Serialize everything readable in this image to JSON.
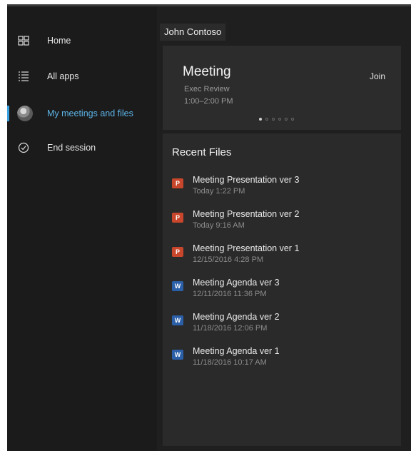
{
  "sidebar": {
    "items": [
      {
        "label": "Home",
        "icon": "home-icon"
      },
      {
        "label": "All apps",
        "icon": "all-apps-icon"
      },
      {
        "label": "My meetings and files",
        "icon": "avatar"
      },
      {
        "label": "End session",
        "icon": "check-circle-icon"
      }
    ]
  },
  "user": {
    "name": "John Contoso"
  },
  "meeting": {
    "title": "Meeting",
    "subtitle": "Exec Review",
    "time": "1:00–2:00 PM",
    "join_label": "Join",
    "page_count": 6,
    "current_page": 1
  },
  "recent": {
    "title": "Recent Files",
    "files": [
      {
        "name": "Meeting Presentation ver 3",
        "date": "Today 1:22 PM",
        "type": "ppt"
      },
      {
        "name": "Meeting Presentation ver 2",
        "date": "Today 9:16 AM",
        "type": "ppt"
      },
      {
        "name": "Meeting Presentation ver 1",
        "date": "12/15/2016 4:28 PM",
        "type": "ppt"
      },
      {
        "name": "Meeting Agenda ver 3",
        "date": "12/11/2016 11:36 PM",
        "type": "doc"
      },
      {
        "name": "Meeting Agenda ver 2",
        "date": "11/18/2016 12:06 PM",
        "type": "doc"
      },
      {
        "name": "Meeting Agenda ver 1",
        "date": "11/18/2016 10:17 AM",
        "type": "doc"
      }
    ]
  },
  "colors": {
    "accent": "#3aa0e0",
    "powerpoint": "#c8462b",
    "word": "#2b5fa8"
  }
}
